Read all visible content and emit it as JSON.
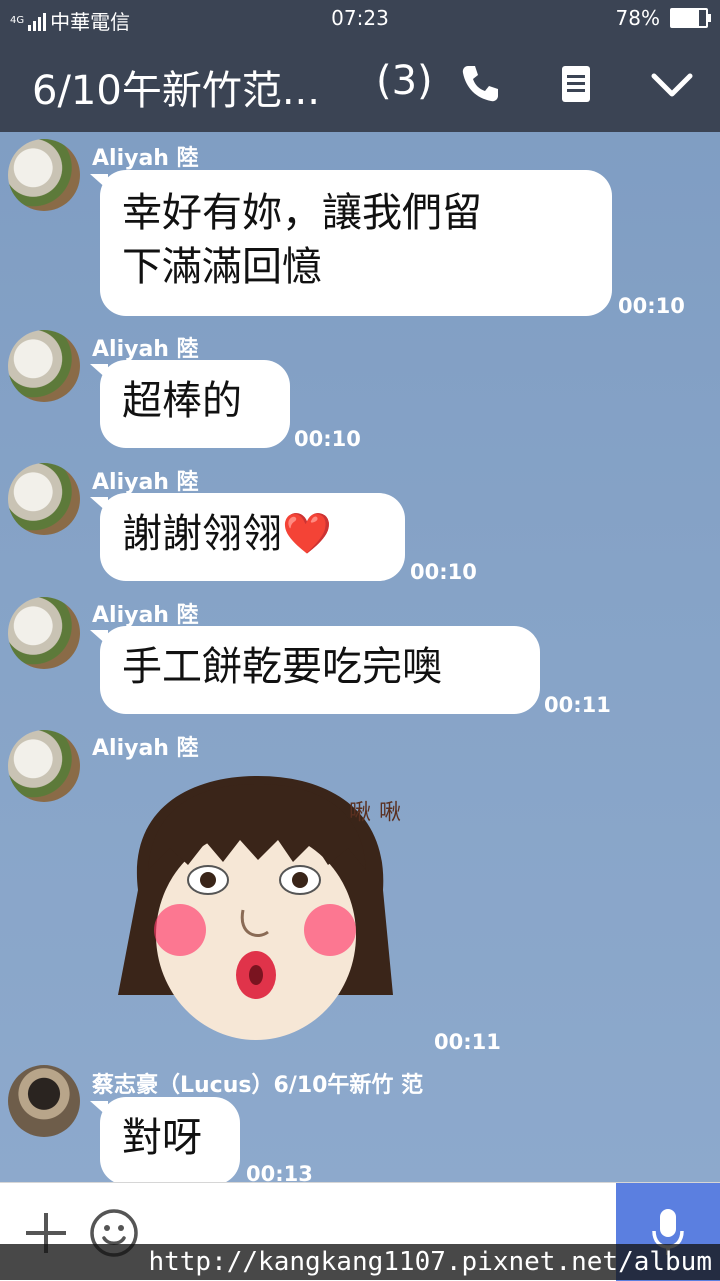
{
  "status_bar": {
    "network": "4G",
    "carrier": "中華電信",
    "time": "07:23",
    "battery": "78%",
    "battery_level": 0.78
  },
  "header": {
    "title": "6/10午新竹范...",
    "member_count": "(3)",
    "icons": [
      "phone-icon",
      "notes-icon",
      "chevron-down-icon"
    ]
  },
  "messages": [
    {
      "sender": "Aliyah 陸",
      "text_line1": "幸好有妳，讓我們留",
      "text_line2": "下滿滿回憶",
      "time": "00:10"
    },
    {
      "sender": "Aliyah 陸",
      "text": "超棒的",
      "time": "00:10"
    },
    {
      "sender": "Aliyah 陸",
      "text": "謝謝翎翎",
      "emoji": "❤️",
      "time": "00:10"
    },
    {
      "sender": "Aliyah 陸",
      "text": "手工餅乾要吃完噢",
      "time": "00:11"
    },
    {
      "sender": "Aliyah 陸",
      "sticker_caption": "啾啾",
      "time": "00:11"
    },
    {
      "sender": "蔡志豪（Lucus）6/10午新竹 范",
      "text": "對呀",
      "time": "00:13"
    }
  ],
  "input_bar": {
    "add_icon": "plus-icon",
    "emoji_icon": "smiley-icon",
    "mic_icon": "microphone-icon"
  },
  "watermark": "http://kangkang1107.pixnet.net/album",
  "colors": {
    "header_bg": "#3b4454",
    "chat_bg": "#86a3c7",
    "bubble": "#ffffff",
    "mic_button": "#5b7fe0"
  }
}
